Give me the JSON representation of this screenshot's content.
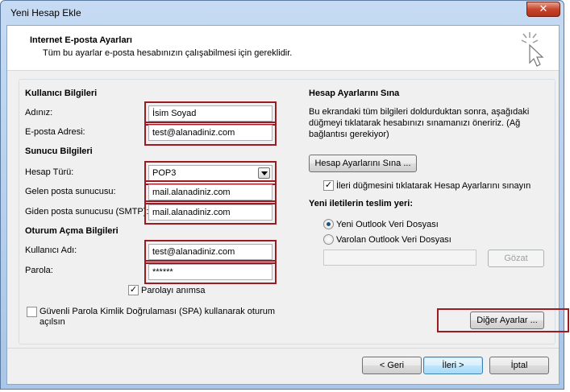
{
  "window": {
    "title": "Yeni Hesap Ekle",
    "close_glyph": "✕"
  },
  "header": {
    "title": "Internet E-posta Ayarları",
    "subtitle": "Tüm bu ayarlar e-posta hesabınızın çalışabilmesi için gereklidir.",
    "icon": "cursor-click-icon"
  },
  "user_info": {
    "section_title": "Kullanıcı Bilgileri",
    "name_label": "Adınız:",
    "name_value": "İsim Soyad",
    "email_label": "E-posta Adresi:",
    "email_value": "test@alanadiniz.com"
  },
  "server_info": {
    "section_title": "Sunucu Bilgileri",
    "account_type_label": "Hesap Türü:",
    "account_type_value": "POP3",
    "incoming_label": "Gelen posta sunucusu:",
    "incoming_value": "mail.alanadiniz.com",
    "outgoing_label": "Giden posta sunucusu (SMTP):",
    "outgoing_value": "mail.alanadiniz.com"
  },
  "logon_info": {
    "section_title": "Oturum Açma Bilgileri",
    "username_label": "Kullanıcı Adı:",
    "username_value": "test@alanadiniz.com",
    "password_label": "Parola:",
    "password_value": "******",
    "remember_label": "Parolayı anımsa",
    "remember_checked": true,
    "spa_label_line1": "Güvenli Parola Kimlik Doğrulaması (SPA) kullanarak oturum",
    "spa_label_line2": "açılsın",
    "spa_checked": false
  },
  "test_settings": {
    "section_title": "Hesap Ayarlarını Sına",
    "description_line1": "Bu ekrandaki tüm bilgileri doldurduktan sonra, aşağıdaki",
    "description_line2": "düğmeyi tıklatarak hesabınızı sınamanızı öneririz. (Ağ",
    "description_line3": "bağlantısı gerekiyor)",
    "test_button": "Hesap Ayarlarını Sına ...",
    "auto_test_label": "İleri düğmesini tıklatarak Hesap Ayarlarını sınayın",
    "auto_test_checked": true
  },
  "delivery": {
    "section_title": "Yeni iletilerin teslim yeri:",
    "option_new": "Yeni Outlook Veri Dosyası",
    "option_existing": "Varolan Outlook Veri Dosyası",
    "selected": "new",
    "path_value": "",
    "browse_button": "Gözat"
  },
  "more_settings_button": "Diğer Ayarlar ...",
  "footer": {
    "back_button": "< Geri",
    "next_button": "İleri >",
    "cancel_button": "İptal"
  },
  "colors": {
    "highlight": "#9b1b23",
    "window_frame": "#a9c6e8",
    "client_bg": "#f0f0f0"
  }
}
